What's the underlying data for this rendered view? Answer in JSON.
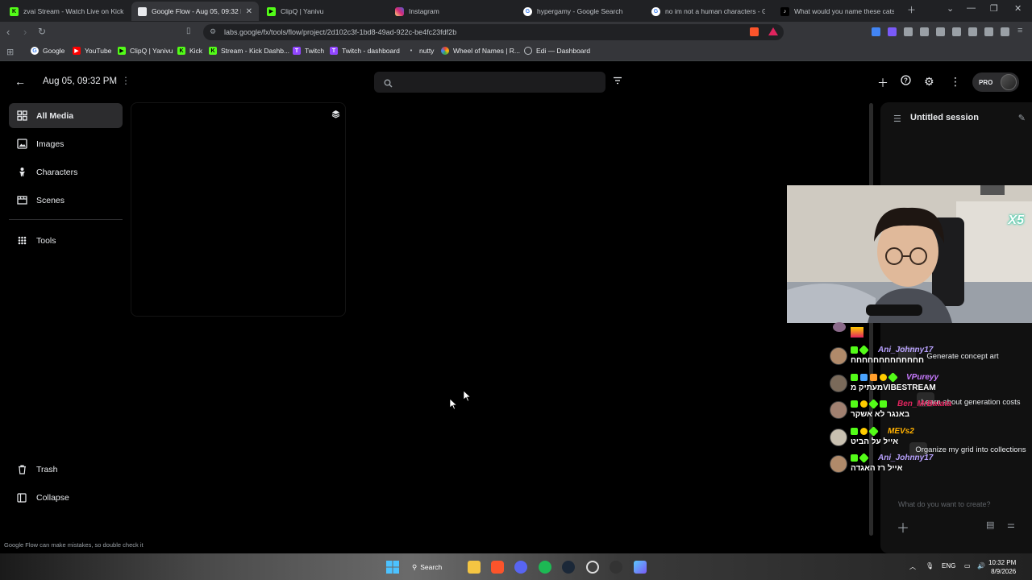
{
  "browser": {
    "tabs": [
      {
        "label": "zvai Stream - Watch Live on Kick",
        "color": "#53fc18",
        "glyph": "K"
      },
      {
        "label": "Google Flow - Aug 05, 09:32 PM",
        "color": "#e8eaed",
        "glyph": ""
      },
      {
        "label": "ClipQ | Yanivu",
        "color": "#53fc18",
        "glyph": "▶"
      },
      {
        "label": "Instagram",
        "color": "#e1306c",
        "glyph": ""
      },
      {
        "label": "hypergamy - Google Search",
        "color": "#ffffff",
        "glyph": "G"
      },
      {
        "label": "no im not a human characters - Go",
        "color": "#ffffff",
        "glyph": "G"
      },
      {
        "label": "What would you name these cats? |",
        "color": "#ffffff",
        "glyph": "♪"
      }
    ],
    "url": "labs.google/fx/tools/flow/project/2d102c3f-1bd8-49ad-922c-be4fc23fdf2b",
    "bookmarks": [
      {
        "label": "Google",
        "color": "#ffffff",
        "glyph": "G"
      },
      {
        "label": "YouTube",
        "color": "#ff0000",
        "glyph": "▶"
      },
      {
        "label": "ClipQ | Yanivu",
        "color": "#53fc18",
        "glyph": "▶"
      },
      {
        "label": "Kick",
        "color": "#53fc18",
        "glyph": "K"
      },
      {
        "label": "Stream - Kick Dashb...",
        "color": "#53fc18",
        "glyph": "K"
      },
      {
        "label": "Twitch",
        "color": "#9146ff",
        "glyph": "T"
      },
      {
        "label": "Twitch - dashboard",
        "color": "#9146ff",
        "glyph": "T"
      },
      {
        "label": "nutty",
        "color": "#bdc1c6",
        "glyph": "•"
      },
      {
        "label": "Wheel of Names | R...",
        "color": "#fbbc04",
        "glyph": "◉"
      },
      {
        "label": "Edi — Dashboard",
        "color": "#bdc1c6",
        "glyph": "◎"
      }
    ]
  },
  "app": {
    "project_title": "Aug 05, 09:32 PM",
    "nav": [
      {
        "label": "All Media",
        "icon": "grid-icon",
        "active": true
      },
      {
        "label": "Images",
        "icon": "image-icon",
        "active": false
      },
      {
        "label": "Characters",
        "icon": "person-icon",
        "active": false
      },
      {
        "label": "Scenes",
        "icon": "film-icon",
        "active": false
      }
    ],
    "tools_label": "Tools",
    "trash_label": "Trash",
    "collapse_label": "Collapse",
    "search_placeholder": "",
    "pro_label": "PRO",
    "footer_note": "Google Flow can make mistakes, so double check it"
  },
  "chat_panel": {
    "session_title": "Untitled session",
    "suggestions": [
      "Generate concept art",
      "Learn about generation costs",
      "Organize my grid into collections"
    ],
    "prompt_placeholder": "What do you want to create?"
  },
  "stream_chat": [
    {
      "user": "Ani_Johnny17",
      "color": "#b9a2ff",
      "text": "חחחחחחחחחחחחח",
      "badges": [
        "#53fc18",
        "#53fc18"
      ]
    },
    {
      "user": "VPureyy",
      "color": "#c87aff",
      "text": "מעתיק מVIBESTREAM",
      "badges": [
        "#53fc18",
        "#4aa3ff",
        "#ff9e2c",
        "#ffcc00",
        "#53fc18"
      ]
    },
    {
      "user": "Ben_MrBatata",
      "color": "#e0245e",
      "text": "באנגר לא אשקר",
      "badges": [
        "#53fc18",
        "#ffcc00",
        "#53fc18",
        "#53fc18"
      ]
    },
    {
      "user": "MEVs2",
      "color": "#ffb000",
      "text": "אייל על הביט",
      "badges": [
        "#53fc18",
        "#ffcc00",
        "#53fc18"
      ]
    },
    {
      "user": "Ani_Johnny17",
      "color": "#b9a2ff",
      "text": "אייל רז האגדה",
      "badges": [
        "#53fc18",
        "#53fc18"
      ]
    }
  ],
  "overlay": {
    "multiplier": "X5"
  },
  "taskbar": {
    "search_label": "Search",
    "lang": "ENG",
    "time": "10:32 PM",
    "date": "8/9/2026"
  }
}
